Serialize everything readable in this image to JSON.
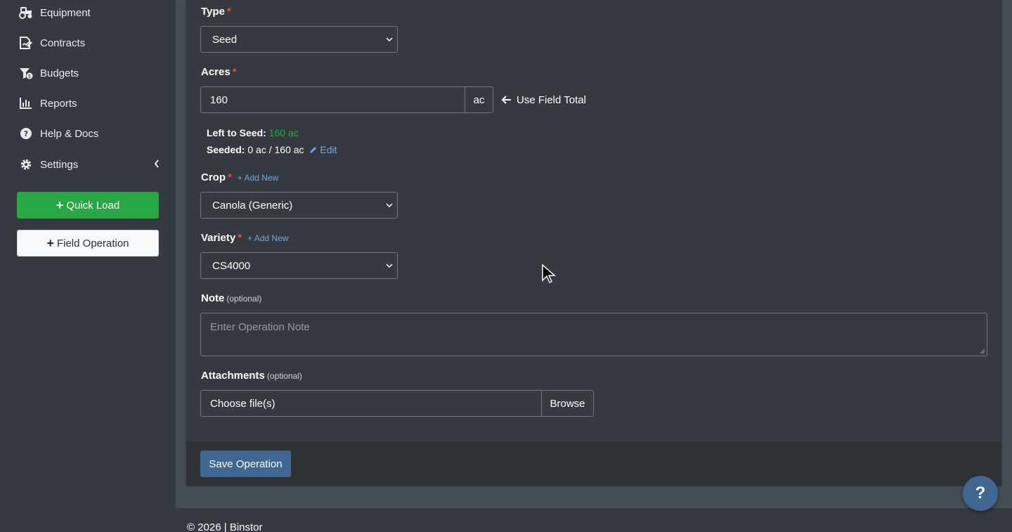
{
  "sidebar": {
    "items": [
      {
        "label": "Equipment",
        "icon": "tractor-icon"
      },
      {
        "label": "Contracts",
        "icon": "contract-icon"
      },
      {
        "label": "Budgets",
        "icon": "budget-icon"
      },
      {
        "label": "Reports",
        "icon": "chart-icon"
      },
      {
        "label": "Help & Docs",
        "icon": "question-circle-icon"
      },
      {
        "label": "Settings",
        "icon": "gear-icon"
      }
    ],
    "quick_load_label": "Quick Load",
    "field_operation_label": "Field Operation"
  },
  "form": {
    "type": {
      "label": "Type",
      "required": "*",
      "value": "Seed"
    },
    "acres": {
      "label": "Acres",
      "required": "*",
      "value": "160",
      "unit": "ac",
      "use_field_total": "Use Field Total"
    },
    "left_to_seed": {
      "label": "Left to Seed:",
      "value": "160 ac"
    },
    "seeded": {
      "label": "Seeded:",
      "value": "0 ac / 160 ac",
      "edit": "Edit"
    },
    "crop": {
      "label": "Crop",
      "required": "*",
      "add_new": "+ Add New",
      "value": "Canola (Generic)"
    },
    "variety": {
      "label": "Variety",
      "required": "*",
      "add_new": "+ Add New",
      "value": "CS4000"
    },
    "note": {
      "label": "Note",
      "optional": "(optional)",
      "placeholder": "Enter Operation Note"
    },
    "attachments": {
      "label": "Attachments",
      "optional": "(optional)",
      "placeholder": "Choose file(s)",
      "browse": "Browse"
    },
    "save_label": "Save Operation"
  },
  "footer": {
    "text": "© 2026 | Binstor"
  },
  "help_fab": {
    "label": "?"
  },
  "colors": {
    "accent": "#3f6791",
    "success": "#28a745",
    "link": "#6fa8e8",
    "required": "#e74c3c"
  }
}
